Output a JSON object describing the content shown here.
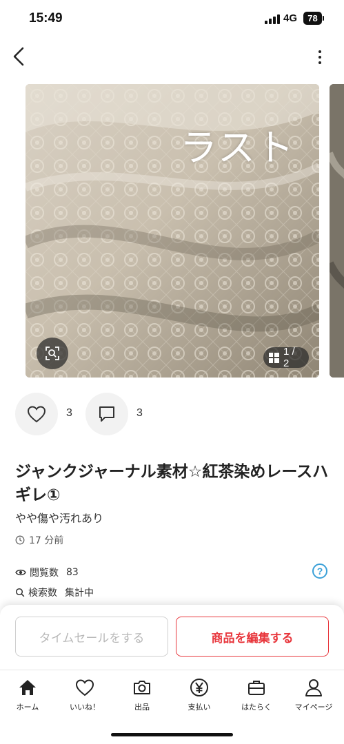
{
  "status_bar": {
    "time": "15:49",
    "network": "4G",
    "battery": "78"
  },
  "header": {
    "back_icon": "chevron-left-icon",
    "more_icon": "more-vertical-icon"
  },
  "gallery": {
    "overlay_text": "ラスト",
    "counter": "1 / 2",
    "zoom_icon": "image-search-icon"
  },
  "actions": {
    "likes_count": "3",
    "comments_count": "3"
  },
  "item": {
    "title": "ジャンクジャーナル素材☆紅茶染めレースハギレ①",
    "condition": "やや傷や汚れあり",
    "posted": "17 分前"
  },
  "stats": {
    "views_label": "閲覧数",
    "views_value": "83",
    "search_label": "検索数",
    "search_value": "集計中",
    "help_icon": "help-circle-icon",
    "help_mark": "?"
  },
  "cta": {
    "timesale_label": "タイムセールをする",
    "edit_label": "商品を編集する"
  },
  "tabs": [
    {
      "label": "ホーム",
      "icon": "home-icon"
    },
    {
      "label": "いいね！",
      "icon": "heart-icon"
    },
    {
      "label": "出品",
      "icon": "camera-icon"
    },
    {
      "label": "支払い",
      "icon": "yen-icon"
    },
    {
      "label": "はたらく",
      "icon": "briefcase-icon"
    },
    {
      "label": "マイページ",
      "icon": "person-icon"
    }
  ],
  "colors": {
    "accent_red": "#e8363c",
    "help_blue": "#3aa0d8",
    "disabled_gray": "#b8b8b8"
  }
}
